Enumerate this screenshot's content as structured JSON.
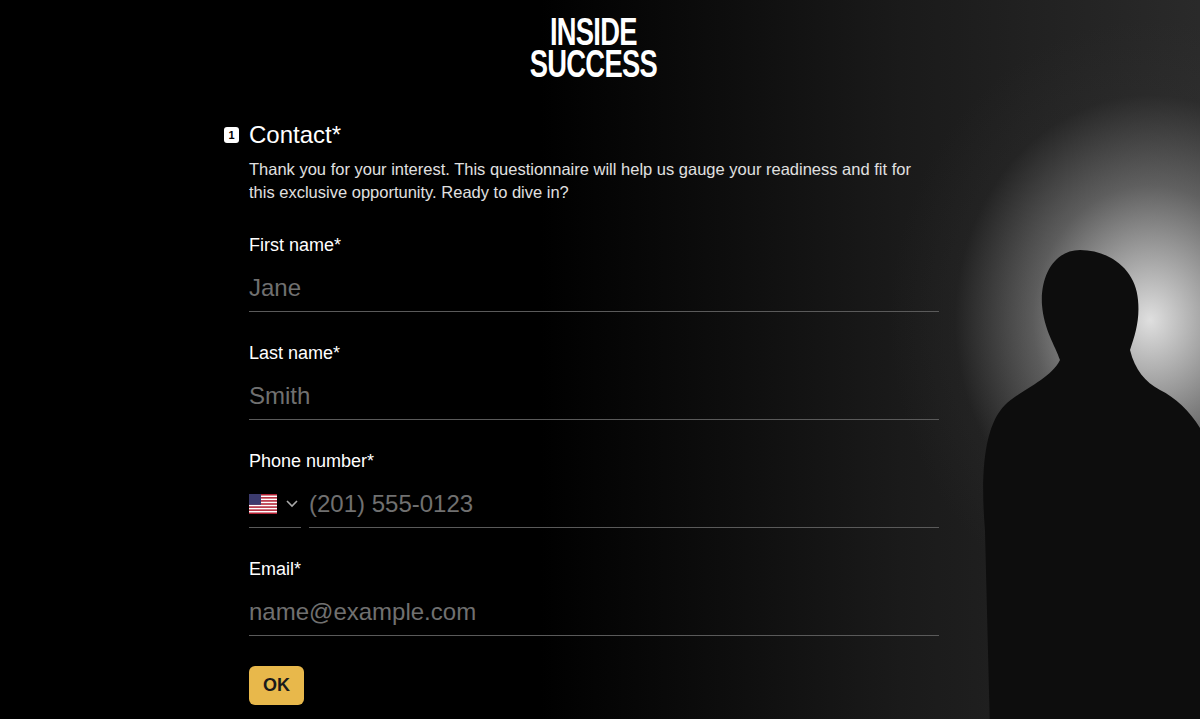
{
  "logo": {
    "line1": "INSIDE",
    "line2": "SUCCESS"
  },
  "question": {
    "number": "1",
    "title": "Contact*",
    "description": "Thank you for your interest. This questionnaire will help us gauge your readiness and fit for this exclusive opportunity. Ready to dive in?"
  },
  "fields": [
    {
      "label": "First name*",
      "placeholder": "Jane",
      "kind": "text"
    },
    {
      "label": "Last name*",
      "placeholder": "Smith",
      "kind": "text"
    },
    {
      "label": "Phone number*",
      "placeholder": "(201) 555-0123",
      "kind": "phone"
    },
    {
      "label": "Email*",
      "placeholder": "name@example.com",
      "kind": "text"
    }
  ],
  "buttons": [
    "OK"
  ]
}
